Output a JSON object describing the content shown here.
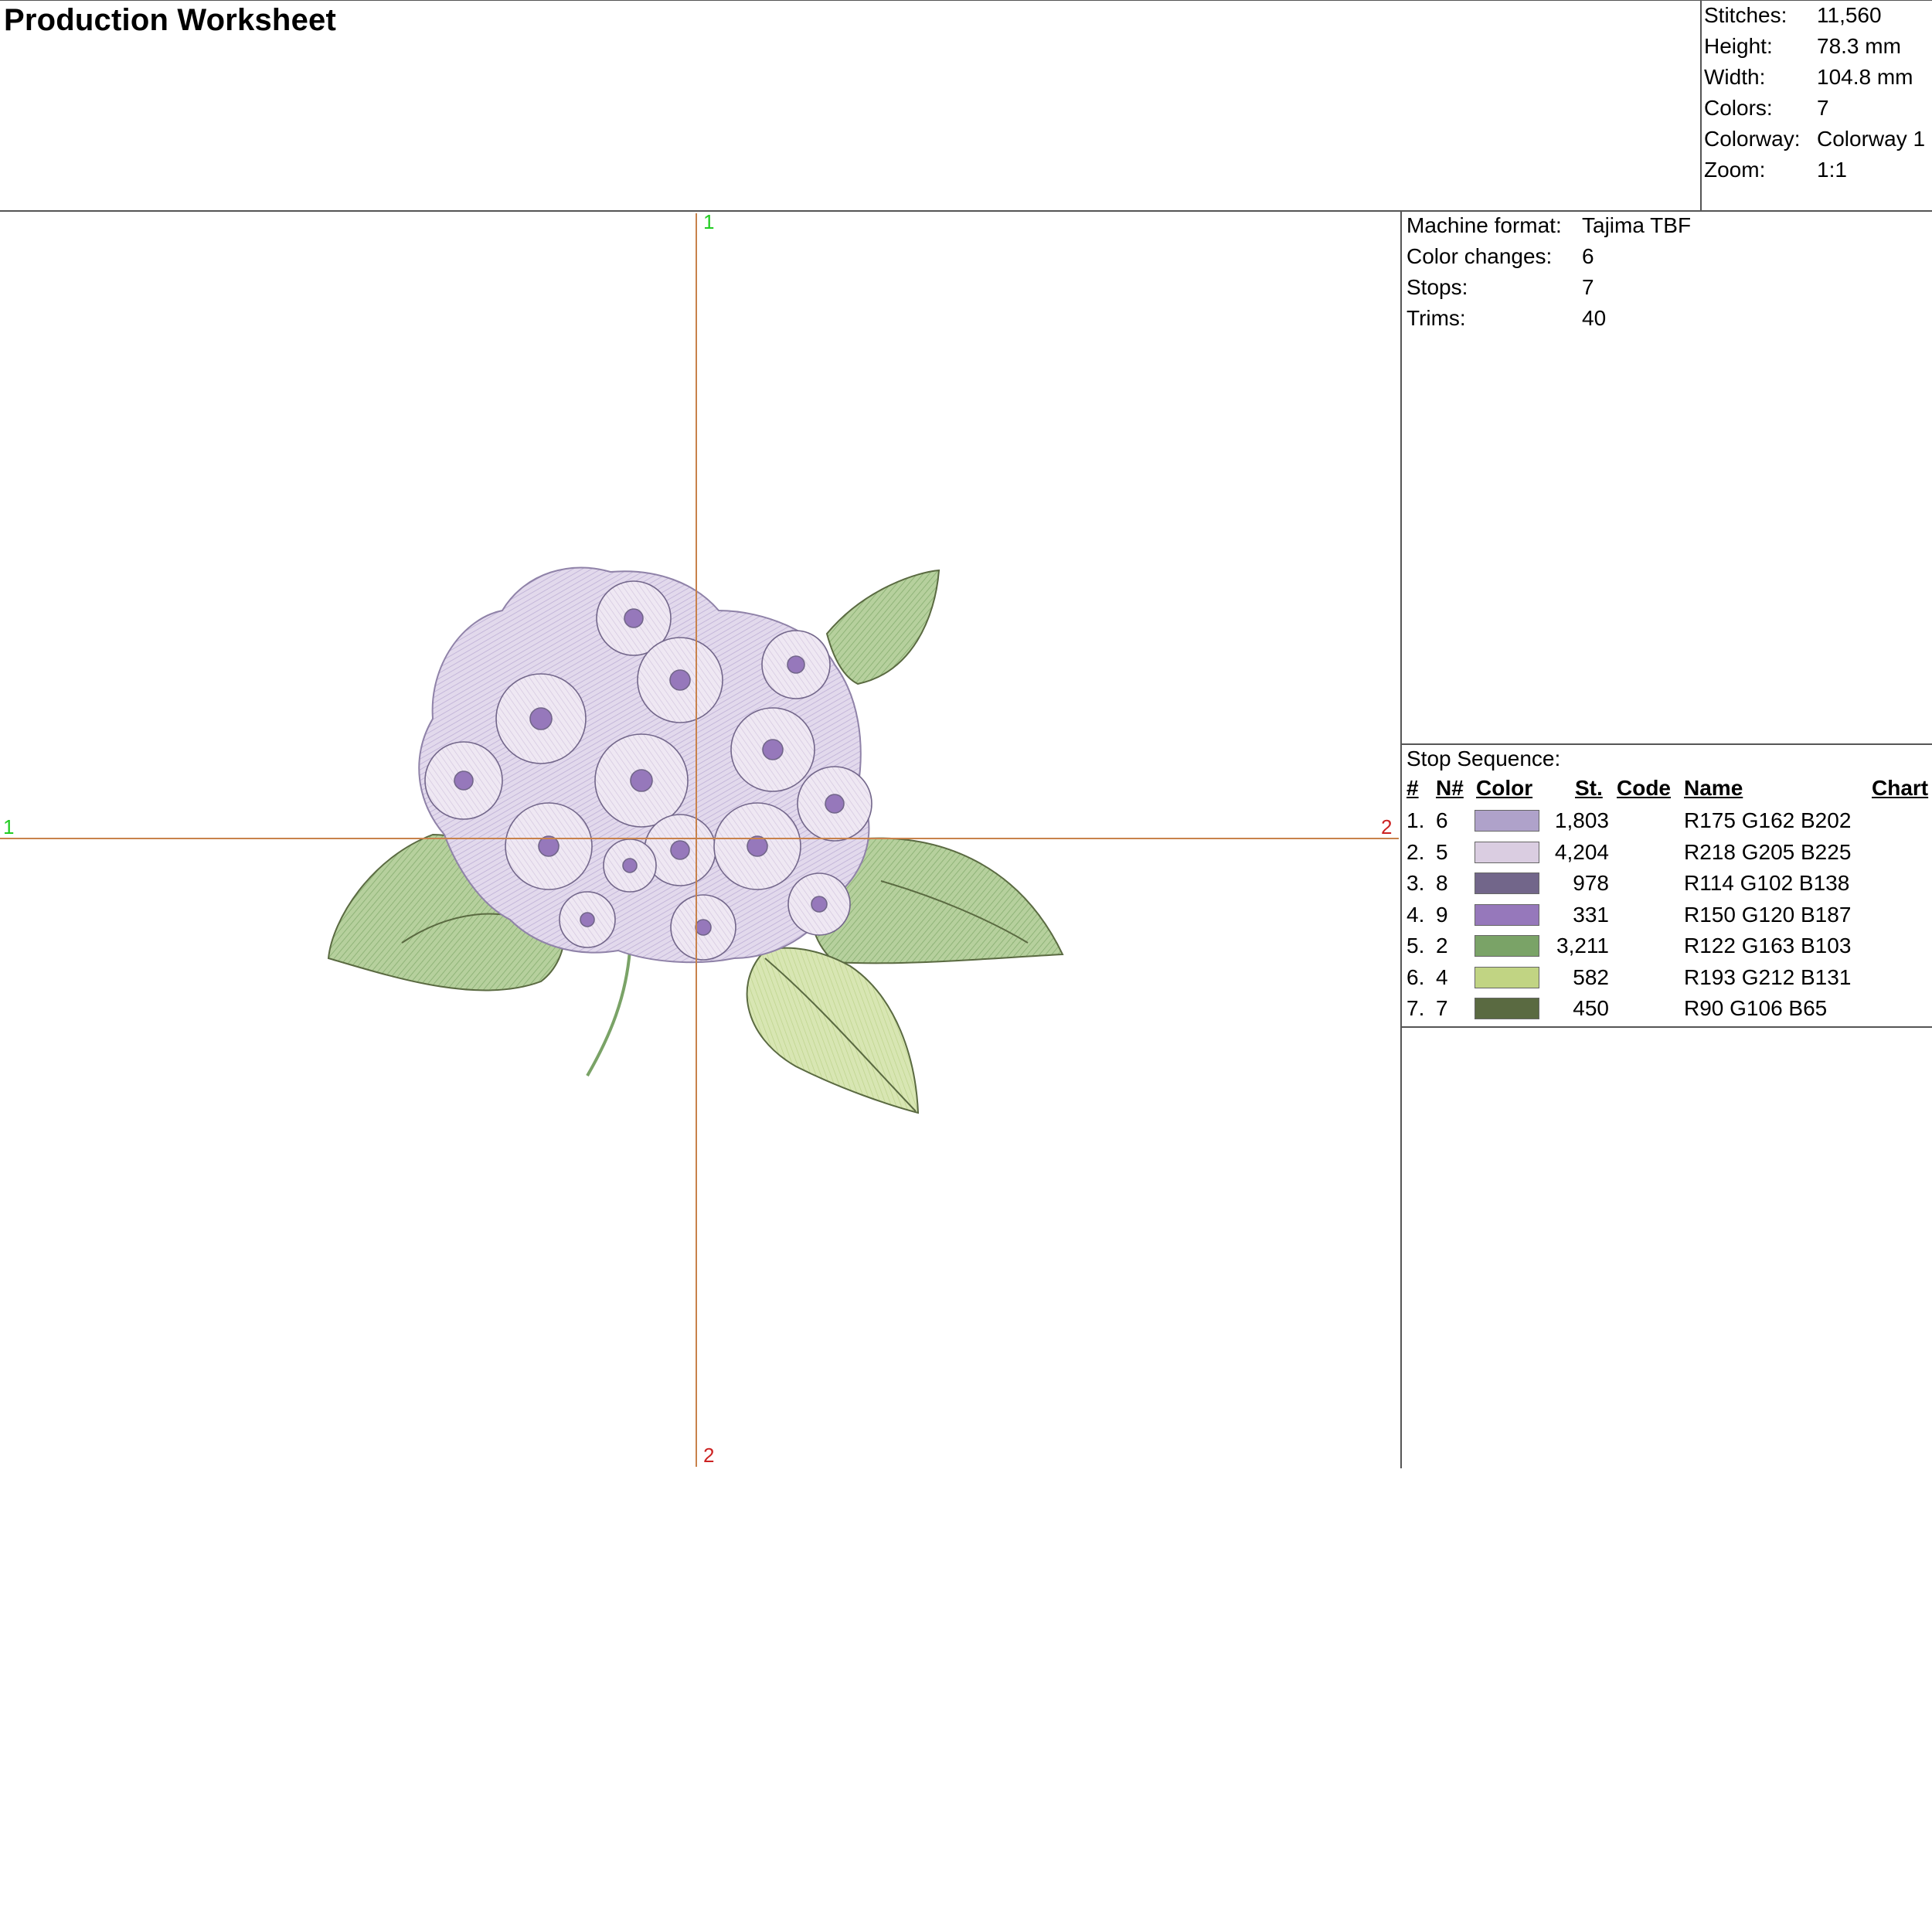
{
  "title": "Production Worksheet",
  "stats": [
    {
      "label": "Stitches:",
      "value": "11,560"
    },
    {
      "label": "Height:",
      "value": "78.3 mm"
    },
    {
      "label": "Width:",
      "value": "104.8 mm"
    },
    {
      "label": "Colors:",
      "value": "7"
    },
    {
      "label": "Colorway:",
      "value": "Colorway 1"
    },
    {
      "label": "Zoom:",
      "value": "1:1"
    }
  ],
  "machine": [
    {
      "label": "Machine format:",
      "value": "Tajima TBF"
    },
    {
      "label": "Color changes:",
      "value": "6"
    },
    {
      "label": "Stops:",
      "value": "7"
    },
    {
      "label": "Trims:",
      "value": "40"
    }
  ],
  "axes": {
    "top": "1",
    "bottom": "2",
    "left": "1",
    "right": "2"
  },
  "stop_sequence": {
    "title": "Stop Sequence:",
    "headers": {
      "num": "#",
      "needle": "N#",
      "color": "Color",
      "stitches": "St.",
      "code": "Code",
      "name": "Name",
      "chart": "Chart"
    },
    "rows": [
      {
        "num": "1.",
        "needle": "6",
        "color": "#AFA2CA",
        "stitches": "1,803",
        "code": "",
        "name": "R175 G162 B202",
        "chart": ""
      },
      {
        "num": "2.",
        "needle": "5",
        "color": "#DACDE1",
        "stitches": "4,204",
        "code": "",
        "name": "R218 G205 B225",
        "chart": ""
      },
      {
        "num": "3.",
        "needle": "8",
        "color": "#72668A",
        "stitches": "978",
        "code": "",
        "name": "R114 G102 B138",
        "chart": ""
      },
      {
        "num": "4.",
        "needle": "9",
        "color": "#9678BB",
        "stitches": "331",
        "code": "",
        "name": "R150 G120 B187",
        "chart": ""
      },
      {
        "num": "5.",
        "needle": "2",
        "color": "#7AA367",
        "stitches": "3,211",
        "code": "",
        "name": "R122 G163 B103",
        "chart": ""
      },
      {
        "num": "6.",
        "needle": "4",
        "color": "#C1D483",
        "stitches": "582",
        "code": "",
        "name": "R193 G212 B131",
        "chart": ""
      },
      {
        "num": "7.",
        "needle": "7",
        "color": "#5A6A41",
        "stitches": "450",
        "code": "",
        "name": "R90 G106 B65",
        "chart": ""
      }
    ]
  }
}
